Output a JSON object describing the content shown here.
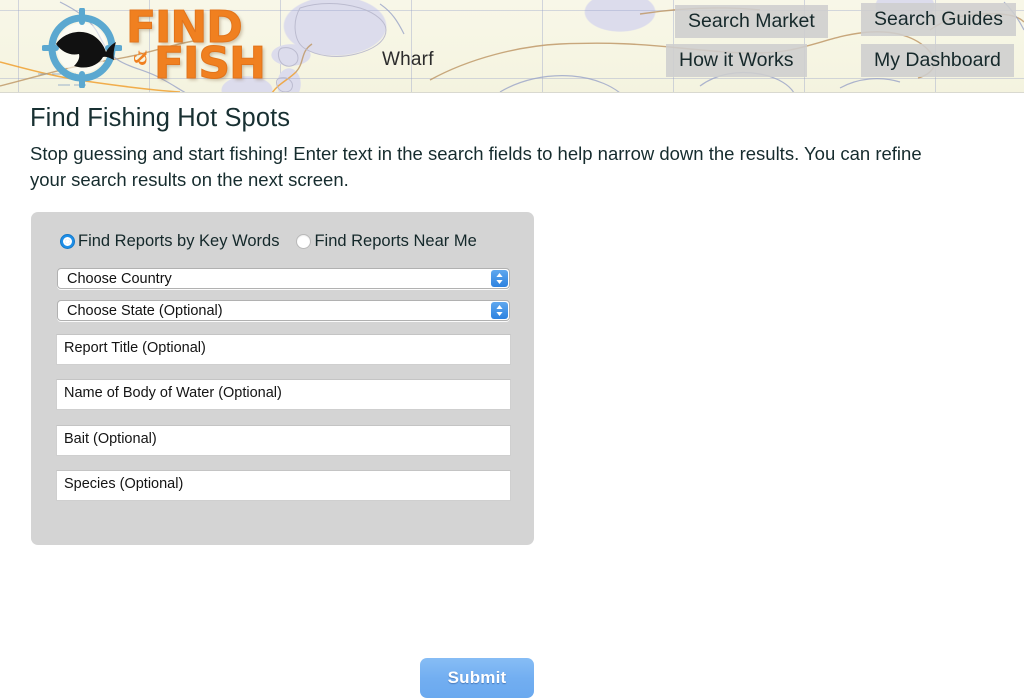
{
  "site": {
    "logo_line1": "FIND",
    "logo_line2": "FISH",
    "logo_amp": "&",
    "logo_icon": "fish-crosshair-logo"
  },
  "header": {
    "map_label": "Wharf",
    "nav": [
      {
        "id": "search-market",
        "label": "Search Market"
      },
      {
        "id": "search-guides",
        "label": "Search Guides"
      },
      {
        "id": "how-it-works",
        "label": "How it Works"
      },
      {
        "id": "my-dashboard",
        "label": "My Dashboard"
      }
    ]
  },
  "main": {
    "title": "Find Fishing Hot Spots",
    "description": "Stop guessing and start fishing! Enter text in the search fields to help narrow down the results. You can refine your search results on the next screen."
  },
  "form": {
    "radios": [
      {
        "id": "by-key-words",
        "label": "Find Reports by Key Words",
        "selected": true
      },
      {
        "id": "near-me",
        "label": "Find Reports Near Me",
        "selected": false
      }
    ],
    "selects": [
      {
        "id": "country",
        "value": "Choose Country"
      },
      {
        "id": "state",
        "value": "Choose State (Optional)"
      }
    ],
    "fields": [
      {
        "id": "report-title",
        "value": "",
        "placeholder": "Report Title (Optional)"
      },
      {
        "id": "body-water",
        "value": "",
        "placeholder": "Name of Body of Water (Optional)"
      },
      {
        "id": "bait",
        "value": "",
        "placeholder": "Bait (Optional)"
      },
      {
        "id": "species",
        "value": "",
        "placeholder": "Species (Optional)"
      }
    ],
    "submit_label": "Submit"
  },
  "colors": {
    "logo_orange": "#f08020",
    "logo_ring_blue": "#5ba8d0",
    "panel_gray": "#d4d4d4",
    "nav_gray": "#cecece",
    "submit_blue": "#72aef1",
    "radio_blue": "#1e8fe8",
    "select_arrow_blue": "#2d82e0",
    "map_paper": "#f6f5e3",
    "map_water": "#dcdcec",
    "map_contour": "#c09a6a",
    "text_dark": "#16292b"
  }
}
